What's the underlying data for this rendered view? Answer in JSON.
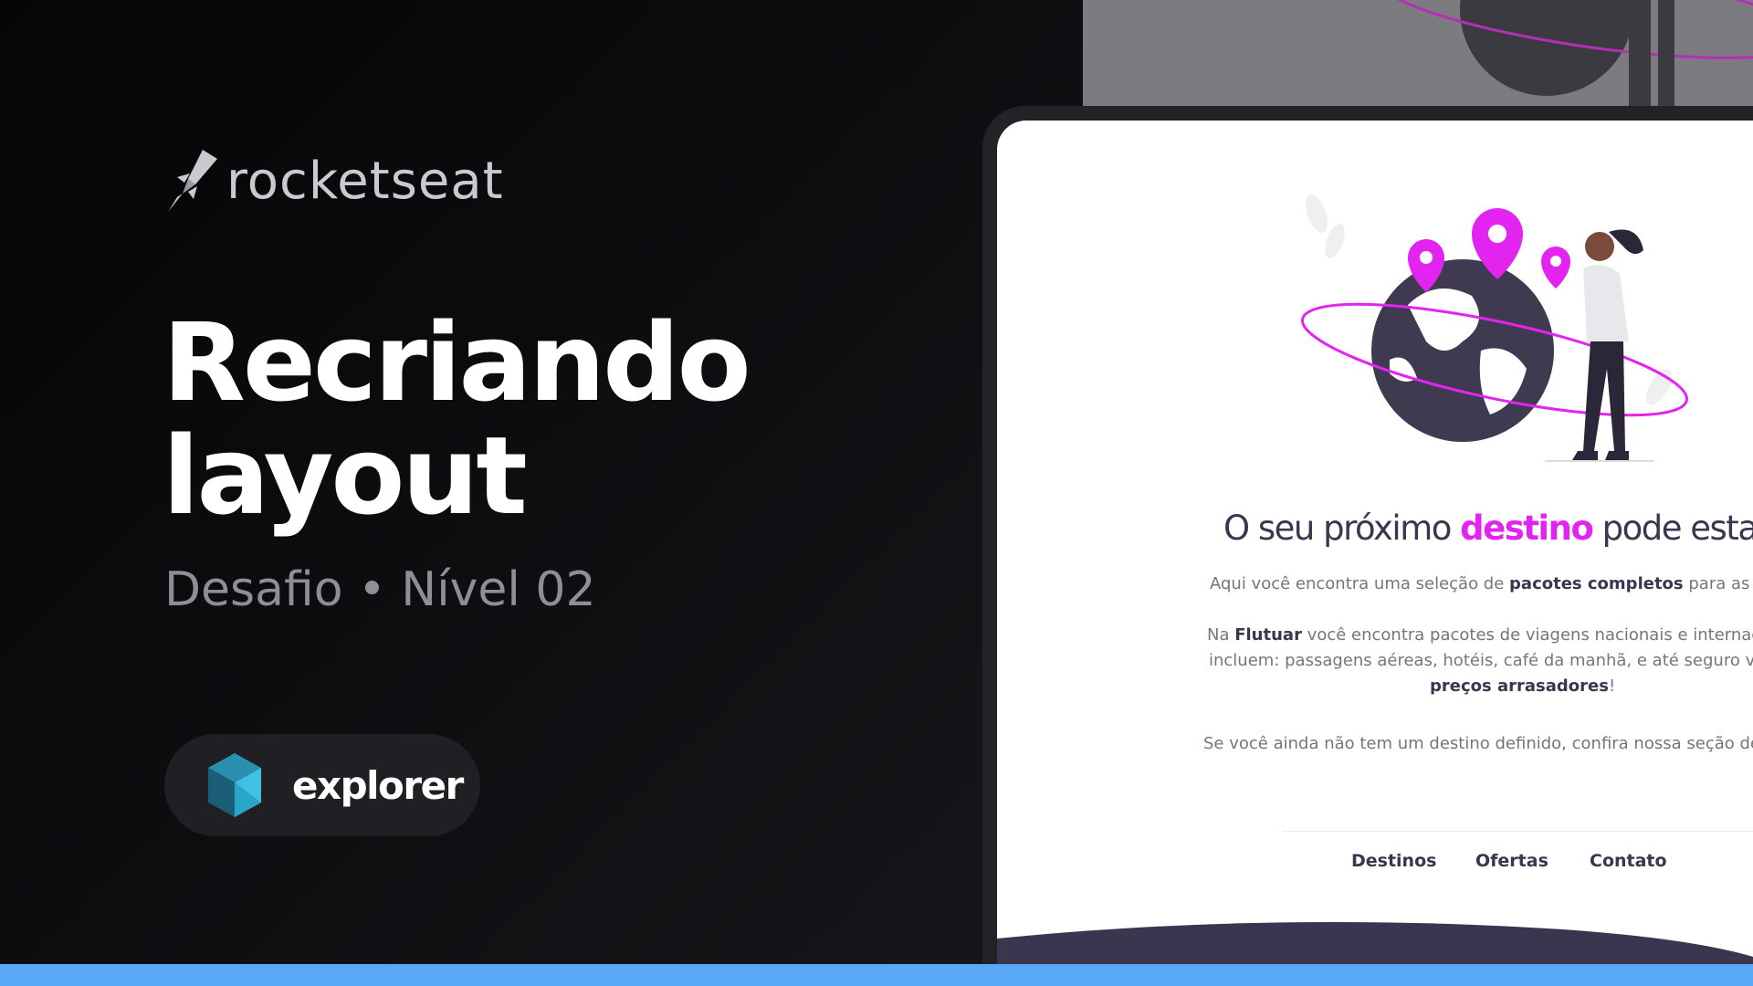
{
  "brand": {
    "name": "rocketseat",
    "icon": "rocket-icon"
  },
  "headline": {
    "line1": "Recriando",
    "line2": "layout"
  },
  "subtitle": "Desafio • Nível 02",
  "badge": {
    "label": "explorer",
    "icon": "explorer-cube-icon"
  },
  "mockup": {
    "title_start": "O seu próximo ",
    "title_accent": "destino",
    "title_end": " pode estar aqu",
    "p1_start": "Aqui você encontra uma seleção de ",
    "p1_bold": "pacotes completos",
    "p1_end": " para as sua",
    "p2_start": "Na ",
    "p2_bold": "Flutuar",
    "p2_end": " você encontra pacotes de viagens nacionais e internacio",
    "p3": "incluem: passagens aéreas, hotéis, café da manhã, e até seguro viag",
    "p4_bold": "preços arrasadores",
    "p4_end": "!",
    "p5": "Se você ainda não tem um destino definido, confira nossa seção de",
    "nav": [
      "Destinos",
      "Ofertas",
      "Contato"
    ]
  },
  "colors": {
    "accent": "#e324f0",
    "text_dark": "#3b3550",
    "bar": "#5aa9f8",
    "cube_light": "#3ec2e0",
    "cube_dark": "#1a5e78"
  }
}
